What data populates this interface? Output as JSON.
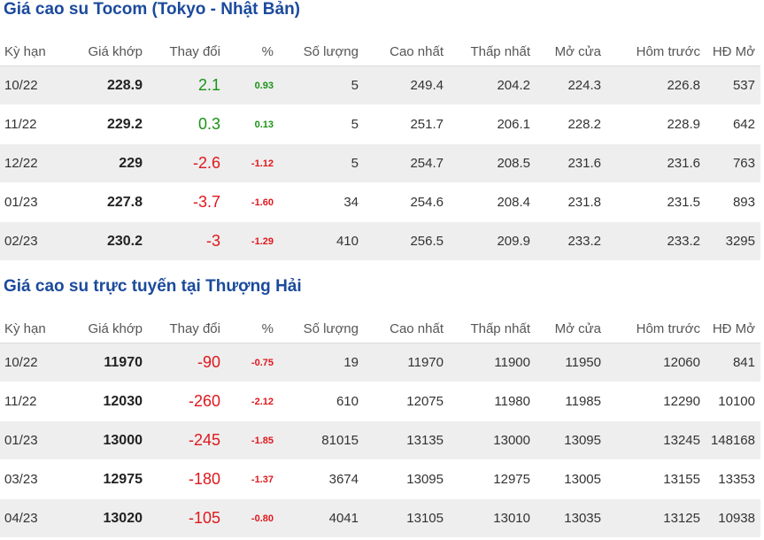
{
  "colors": {
    "title": "#1b4a9c",
    "up": "#1a9316",
    "down": "#e0171c",
    "row_stripe": "#eeeeee"
  },
  "columns": [
    "Kỳ hạn",
    "Giá khớp",
    "Thay đổi",
    "%",
    "Số lượng",
    "Cao nhất",
    "Thấp nhất",
    "Mở cửa",
    "Hôm trước",
    "HĐ Mở"
  ],
  "tocom": {
    "title": "Giá cao su Tocom (Tokyo - Nhật Bản)",
    "rows": [
      {
        "term": "10/22",
        "match": "228.9",
        "change": "2.1",
        "pct": "0.93",
        "dir": "up",
        "volume": "5",
        "high": "249.4",
        "low": "204.2",
        "open": "224.3",
        "prev": "226.8",
        "oi": "537"
      },
      {
        "term": "11/22",
        "match": "229.2",
        "change": "0.3",
        "pct": "0.13",
        "dir": "up",
        "volume": "5",
        "high": "251.7",
        "low": "206.1",
        "open": "228.2",
        "prev": "228.9",
        "oi": "642"
      },
      {
        "term": "12/22",
        "match": "229",
        "change": "-2.6",
        "pct": "-1.12",
        "dir": "down",
        "volume": "5",
        "high": "254.7",
        "low": "208.5",
        "open": "231.6",
        "prev": "231.6",
        "oi": "763"
      },
      {
        "term": "01/23",
        "match": "227.8",
        "change": "-3.7",
        "pct": "-1.60",
        "dir": "down",
        "volume": "34",
        "high": "254.6",
        "low": "208.4",
        "open": "231.8",
        "prev": "231.5",
        "oi": "893"
      },
      {
        "term": "02/23",
        "match": "230.2",
        "change": "-3",
        "pct": "-1.29",
        "dir": "down",
        "volume": "410",
        "high": "256.5",
        "low": "209.9",
        "open": "233.2",
        "prev": "233.2",
        "oi": "3295"
      }
    ]
  },
  "shanghai": {
    "title": "Giá cao su trực tuyến tại Thượng Hải",
    "rows": [
      {
        "term": "10/22",
        "match": "11970",
        "change": "-90",
        "pct": "-0.75",
        "dir": "down",
        "volume": "19",
        "high": "11970",
        "low": "11900",
        "open": "11950",
        "prev": "12060",
        "oi": "841"
      },
      {
        "term": "11/22",
        "match": "12030",
        "change": "-260",
        "pct": "-2.12",
        "dir": "down",
        "volume": "610",
        "high": "12075",
        "low": "11980",
        "open": "11985",
        "prev": "12290",
        "oi": "10100"
      },
      {
        "term": "01/23",
        "match": "13000",
        "change": "-245",
        "pct": "-1.85",
        "dir": "down",
        "volume": "81015",
        "high": "13135",
        "low": "13000",
        "open": "13095",
        "prev": "13245",
        "oi": "148168"
      },
      {
        "term": "03/23",
        "match": "12975",
        "change": "-180",
        "pct": "-1.37",
        "dir": "down",
        "volume": "3674",
        "high": "13095",
        "low": "12975",
        "open": "13005",
        "prev": "13155",
        "oi": "13353"
      },
      {
        "term": "04/23",
        "match": "13020",
        "change": "-105",
        "pct": "-0.80",
        "dir": "down",
        "volume": "4041",
        "high": "13105",
        "low": "13010",
        "open": "13035",
        "prev": "13125",
        "oi": "10938"
      }
    ]
  }
}
